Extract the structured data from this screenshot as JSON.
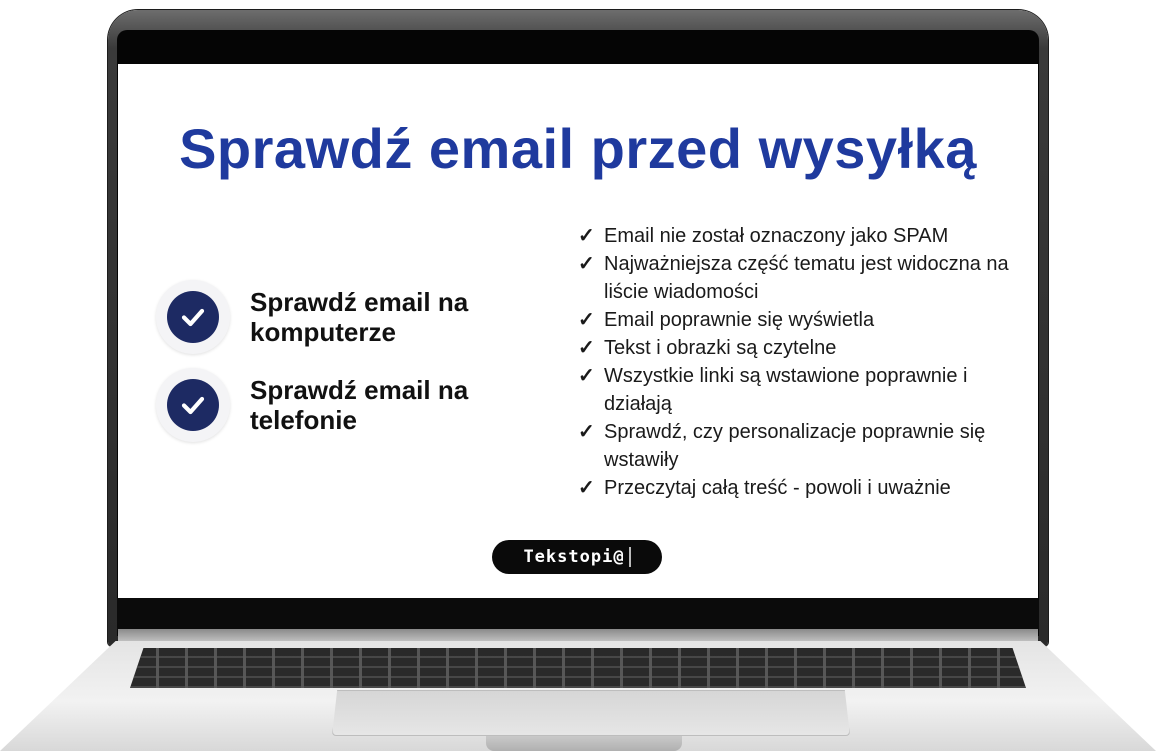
{
  "slide": {
    "title": "Sprawdź email przed wysyłką",
    "check_items": [
      {
        "label": "Sprawdź email na komputerze",
        "icon": "check-circle-icon"
      },
      {
        "label": "Sprawdź email na telefonie",
        "icon": "check-circle-icon"
      }
    ],
    "checklist": [
      "Email nie został oznaczony jako SPAM",
      "Najważniejsza część tematu jest widoczna na liście wiadomości",
      "Email poprawnie się wyświetla",
      "Tekst i obrazki są czytelne",
      "Wszystkie linki są wstawione poprawnie i działają",
      "Sprawdź, czy personalizacje poprawnie się wstawiły",
      "Przeczytaj całą treść - powoli i uważnie"
    ],
    "tick_glyph": "✓",
    "brand": "Tekstopi@"
  },
  "colors": {
    "title": "#1f3a9e",
    "badge": "#1d2a63",
    "pill": "#0a0a0a"
  }
}
